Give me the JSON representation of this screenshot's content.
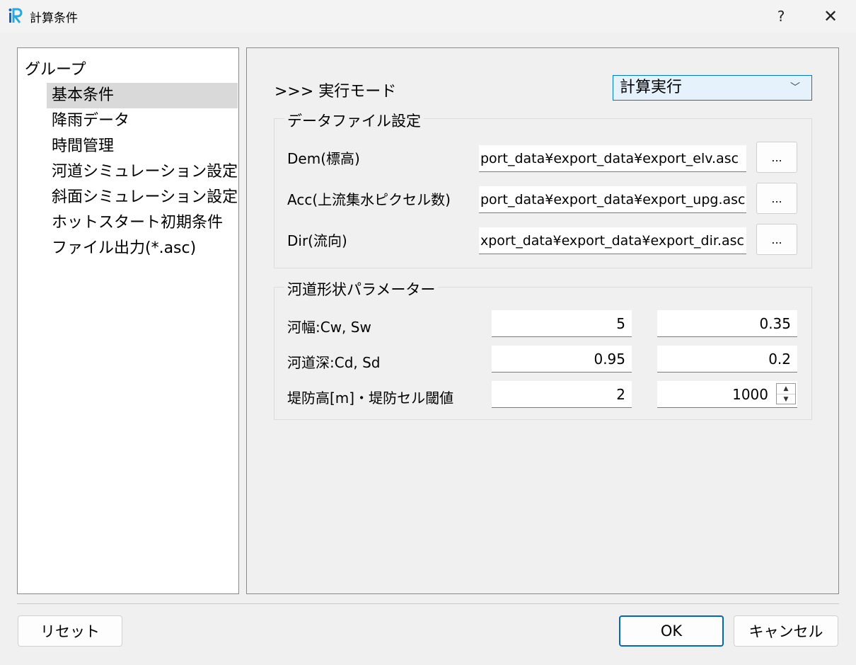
{
  "window": {
    "title": "計算条件",
    "help_label": "?",
    "close_label": "✕"
  },
  "tree": {
    "header": "グループ",
    "items": [
      {
        "label": "基本条件",
        "selected": true
      },
      {
        "label": "降雨データ"
      },
      {
        "label": "時間管理"
      },
      {
        "label": "河道シミュレーション設定"
      },
      {
        "label": "斜面シミュレーション設定"
      },
      {
        "label": "ホットスタート初期条件"
      },
      {
        "label": "ファイル出力(*.asc)"
      }
    ]
  },
  "mode": {
    "label": ">>> 実行モード",
    "value": "計算実行"
  },
  "data_files": {
    "title": "データファイル設定",
    "rows": [
      {
        "label": "Dem(標高)",
        "value": "port_data¥export_data¥export_elv.asc",
        "button": "..."
      },
      {
        "label": "Acc(上流集水ピクセル数)",
        "value": "port_data¥export_data¥export_upg.asc",
        "button": "..."
      },
      {
        "label": "Dir(流向)",
        "value": "xport_data¥export_data¥export_dir.asc",
        "button": "..."
      }
    ]
  },
  "channel_params": {
    "title": "河道形状パラメーター",
    "rows": [
      {
        "label": "河幅:Cw, Sw",
        "v1": "5",
        "v2": "0.35"
      },
      {
        "label": "河道深:Cd, Sd",
        "v1": "0.95",
        "v2": "0.2"
      },
      {
        "label": "堤防高[m]・堤防セル閾値",
        "v1": "2",
        "v2": "1000"
      }
    ]
  },
  "buttons": {
    "reset": "リセット",
    "ok": "OK",
    "cancel": "キャンセル"
  },
  "colors": {
    "accent": "#0078d4",
    "selected_row": "#d9d9d9"
  }
}
